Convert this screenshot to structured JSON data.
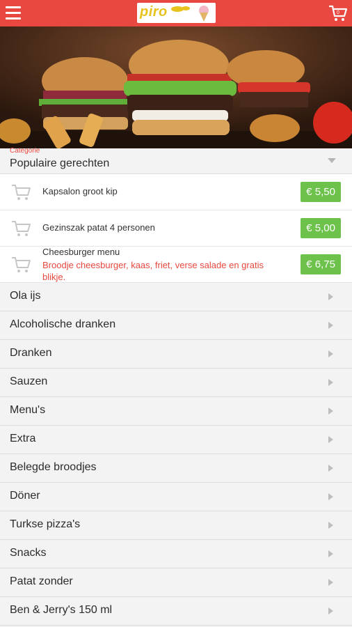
{
  "header": {
    "logo_text": "piro",
    "menu_icon": "hamburger-menu-icon",
    "cart_icon": "shopping-cart-icon",
    "brand_color": "#e8483f"
  },
  "category": {
    "label": "Categorie",
    "title": "Populaire gerechten"
  },
  "products": [
    {
      "name": "Kapsalon groot kip",
      "description": "",
      "price": "€ 5,50"
    },
    {
      "name": "Gezinszak patat 4 personen",
      "description": "",
      "price": "€ 5,00"
    },
    {
      "name": "Cheesburger menu",
      "description": "Broodje cheesburger, kaas, friet, verse salade en gratis blikje.",
      "price": "€ 6,75"
    }
  ],
  "categories": [
    "Ola ijs",
    "Alcoholische dranken",
    "Dranken",
    "Sauzen",
    "Menu's",
    "Extra",
    "Belegde broodjes",
    "Döner",
    "Turkse pizza's",
    "Snacks",
    "Patat zonder",
    "Ben & Jerry's 150 ml"
  ],
  "colors": {
    "price_bg": "#6cc24a",
    "accent": "#e8483f"
  }
}
